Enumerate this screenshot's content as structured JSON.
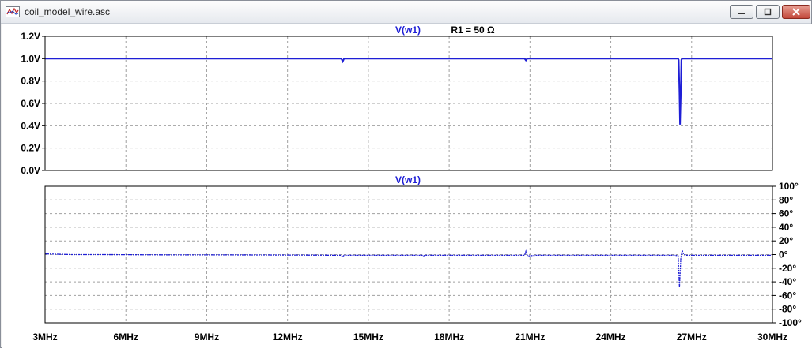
{
  "window": {
    "title": "coil_model_wire.asc",
    "app_icon": "waveform-icon",
    "controls": {
      "minimize": "minimize-icon",
      "maximize": "maximize-icon",
      "close": "close-icon"
    }
  },
  "colors": {
    "trace": "#1f1fd6",
    "grid": "#a0a0a0",
    "frame": "#000000",
    "label": "#000000"
  },
  "chart_data": [
    {
      "type": "line",
      "title": "V(w1)",
      "annotation": "R1 = 50 Ω",
      "xlabel": "",
      "ylabel": "",
      "xlim": [
        3,
        30
      ],
      "ylim": [
        0,
        1.2
      ],
      "grid": true,
      "x_tick_labels": [
        "3MHz",
        "6MHz",
        "9MHz",
        "12MHz",
        "15MHz",
        "18MHz",
        "21MHz",
        "24MHz",
        "27MHz",
        "30MHz"
      ],
      "y_tick_labels": [
        "0.0V",
        "0.2V",
        "0.4V",
        "0.6V",
        "0.8V",
        "1.0V",
        "1.2V"
      ],
      "series": [
        {
          "x": [
            3,
            14.0,
            14.05,
            14.1,
            20.8,
            20.85,
            20.9,
            26.5,
            26.52,
            26.55,
            26.57,
            26.6,
            26.62,
            26.65,
            26.7,
            30
          ],
          "values": [
            1.0,
            1.0,
            0.975,
            1.0,
            1.0,
            0.985,
            1.0,
            1.0,
            0.99,
            0.7,
            0.41,
            0.7,
            0.99,
            1.0,
            1.0,
            1.0
          ]
        }
      ]
    },
    {
      "type": "line",
      "title": "V(w1)",
      "xlabel": "",
      "ylabel": "",
      "xlim": [
        3,
        30
      ],
      "ylim": [
        -100,
        100
      ],
      "grid": true,
      "y_axis_side": "right",
      "y_tick_labels": [
        "100°",
        "80°",
        "60°",
        "40°",
        "20°",
        "0°",
        "-20°",
        "-40°",
        "-60°",
        "-80°",
        "-100°"
      ],
      "series": [
        {
          "x": [
            3,
            4,
            5,
            8,
            10,
            13,
            14.0,
            14.05,
            14.1,
            16,
            17,
            17.05,
            17.1,
            20.5,
            20.8,
            20.85,
            20.9,
            20.95,
            21.2,
            23,
            24,
            26.4,
            26.5,
            26.55,
            26.6,
            26.65,
            26.7,
            26.8,
            27,
            28,
            29,
            30
          ],
          "values": [
            1,
            0,
            0,
            -0.5,
            -0.5,
            -0.8,
            -1,
            -3,
            -1,
            -1,
            -1,
            -2,
            -1,
            -1,
            -1,
            5,
            -1,
            -2,
            -1,
            -1,
            -1,
            -1,
            -2,
            -48,
            -5,
            6,
            0,
            -1,
            -1,
            -1,
            -1,
            -1
          ]
        }
      ]
    }
  ]
}
